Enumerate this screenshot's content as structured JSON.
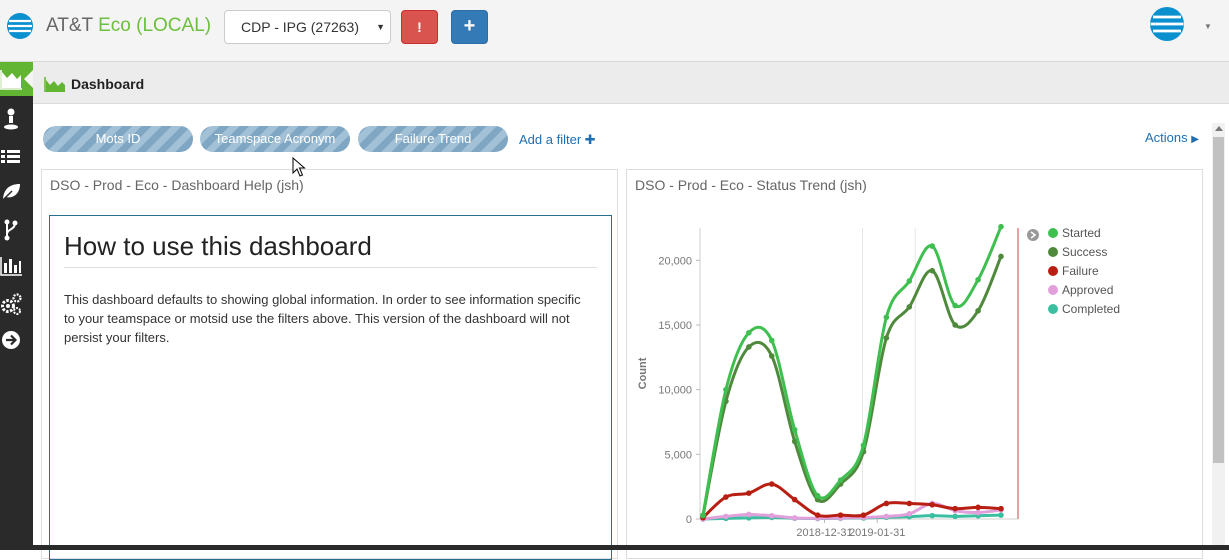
{
  "app": {
    "title_prefix": "AT&T ",
    "title_eco": "Eco",
    "title_env": " (LOCAL)",
    "brand_blue": "#0a8fcf",
    "brand_green": "#6cbf3c"
  },
  "toolbar": {
    "team_select_value": "CDP - IPG (27263)",
    "alert_label": "!",
    "add_label": "+"
  },
  "sidebar": {
    "items": [
      {
        "icon": "area-chart-icon",
        "active": true
      },
      {
        "icon": "user-icon"
      },
      {
        "icon": "list-icon"
      },
      {
        "icon": "leaf-icon"
      },
      {
        "icon": "branch-icon"
      },
      {
        "icon": "bar-chart-icon"
      },
      {
        "icon": "cogs-icon"
      },
      {
        "icon": "arrow-right-circle-icon"
      }
    ]
  },
  "header": {
    "title": "Dashboard"
  },
  "filters": {
    "pills": [
      "Mots ID",
      "Teamspace Acronym",
      "Failure Trend"
    ],
    "add_filter_label": "Add a filter",
    "actions_label": "Actions"
  },
  "help_panel": {
    "title": "DSO - Prod - Eco - Dashboard Help (jsh)",
    "heading": "How to use this dashboard",
    "body": "This dashboard defaults to showing global information. In order to see information specific to your teamspace or motsid use the filters above. This version of the dashboard will not persist your filters."
  },
  "trend_panel": {
    "title": "DSO - Prod - Eco - Status Trend (jsh)"
  },
  "chart_data": {
    "type": "line",
    "ylabel": "Count",
    "ylim": [
      0,
      22500
    ],
    "yticks": [
      0,
      5000,
      10000,
      15000,
      20000
    ],
    "ytick_labels": [
      "0",
      "5,000",
      "10,000",
      "15,000",
      "20,000"
    ],
    "xtick_labels": [
      "2018-12-31",
      "2019-01-31"
    ],
    "legend_position": "right",
    "series": [
      {
        "name": "Started",
        "color": "#3fbf4f",
        "values": [
          300,
          10000,
          14400,
          13800,
          6900,
          1800,
          3000,
          5700,
          15600,
          18400,
          21100,
          16500,
          18500,
          22600
        ]
      },
      {
        "name": "Success",
        "color": "#4f8a3c",
        "values": [
          250,
          9100,
          13300,
          12600,
          6000,
          1500,
          2700,
          5200,
          14000,
          16400,
          19200,
          15000,
          16100,
          20300
        ]
      },
      {
        "name": "Failure",
        "color": "#b81f12",
        "values": [
          100,
          1700,
          2000,
          2700,
          1500,
          300,
          300,
          300,
          1200,
          1200,
          1100,
          800,
          900,
          800
        ]
      },
      {
        "name": "Approved",
        "color": "#e19fdc",
        "values": [
          0,
          200,
          350,
          250,
          80,
          60,
          80,
          120,
          200,
          400,
          1200,
          650,
          500,
          700
        ]
      },
      {
        "name": "Completed",
        "color": "#3cbfa0",
        "values": [
          0,
          50,
          90,
          120,
          60,
          40,
          60,
          80,
          130,
          180,
          260,
          200,
          250,
          300
        ]
      }
    ]
  }
}
